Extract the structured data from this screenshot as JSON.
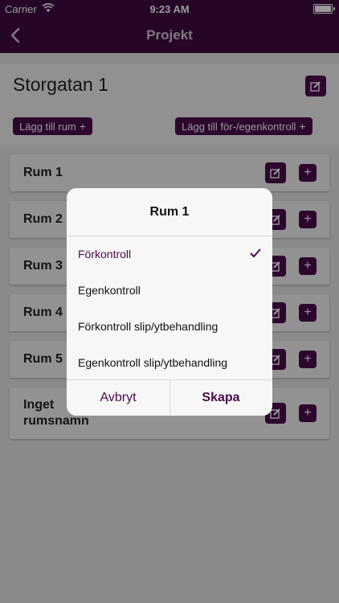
{
  "status": {
    "carrier": "Carrier",
    "time": "9:23 AM"
  },
  "nav": {
    "title": "Projekt"
  },
  "project": {
    "title": "Storgatan 1"
  },
  "actions": {
    "add_room": "Lägg till rum",
    "add_check": "Lägg till för-/egenkontroll",
    "plus": "+"
  },
  "rooms": [
    {
      "name": "Rum 1"
    },
    {
      "name": "Rum 2"
    },
    {
      "name": "Rum 3"
    },
    {
      "name": "Rum 4"
    },
    {
      "name": "Rum 5"
    },
    {
      "name": "Inget rumsnamn"
    }
  ],
  "dialog": {
    "title": "Rum 1",
    "options": [
      {
        "label": "Förkontroll",
        "selected": true
      },
      {
        "label": "Egenkontroll",
        "selected": false
      },
      {
        "label": "Förkontroll slip/ytbehandling",
        "selected": false
      },
      {
        "label": "Egenkontroll slip/ytbehandling",
        "selected": false
      }
    ],
    "cancel": "Avbryt",
    "create": "Skapa"
  },
  "colors": {
    "brand": "#3e0a40",
    "accent": "#4b0a4d"
  }
}
